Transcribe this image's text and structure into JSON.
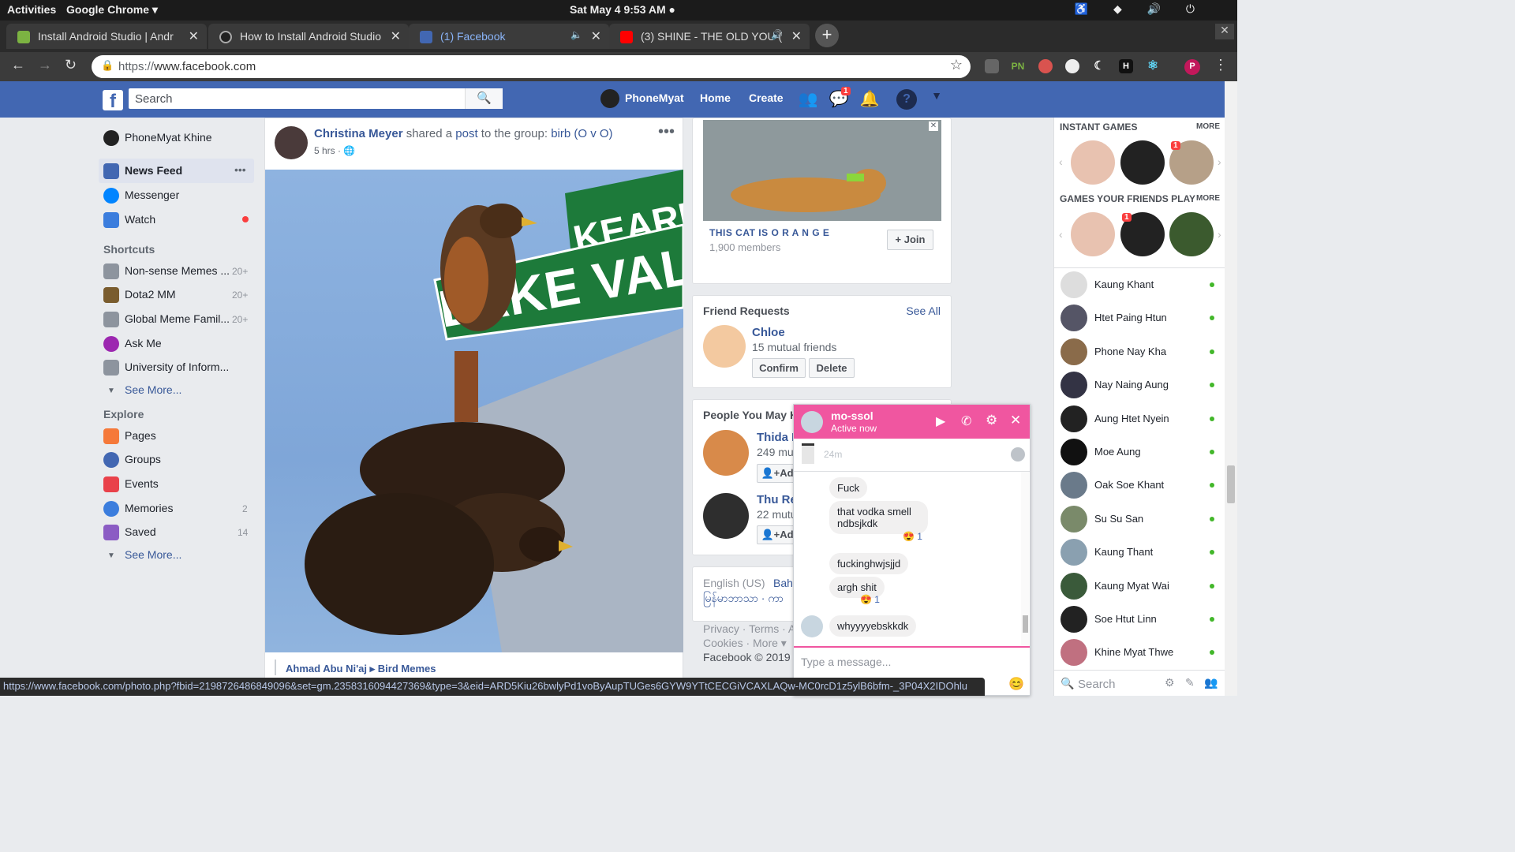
{
  "gnome": {
    "activities": "Activities",
    "app": "Google Chrome ▾",
    "clock": "Sat May 4   9:53 AM ●"
  },
  "tabs": [
    {
      "title": "Install Android Studio  |  Andr",
      "fav_color": "#7cb342"
    },
    {
      "title": "How to Install Android Studio",
      "fav_color": "#222222"
    },
    {
      "title": "(1) Facebook",
      "fav_color": "#4267b2"
    },
    {
      "title": "(3) SHINE - THE OLD YOU (",
      "fav_color": "#ff0000"
    }
  ],
  "omnibox": {
    "scheme": "https://",
    "host": "www.facebook.com"
  },
  "extensions": {
    "pn": "PN",
    "profile": "P"
  },
  "fb": {
    "logo": "f",
    "search_placeholder": "Search",
    "user": "PhoneMyat",
    "home": "Home",
    "create": "Create",
    "messenger_badge": "1",
    "brand_color": "#4267b2"
  },
  "leftnav": {
    "profile": "PhoneMyat Khine",
    "main": [
      {
        "label": "News Feed"
      },
      {
        "label": "Messenger"
      },
      {
        "label": "Watch"
      }
    ],
    "news_more": "•••",
    "shortcuts_title": "Shortcuts",
    "shortcuts": [
      {
        "label": "Non-sense Memes ...",
        "count": "20+"
      },
      {
        "label": "Dota2 MM",
        "count": "20+"
      },
      {
        "label": "Global Meme Famil...",
        "count": "20+"
      },
      {
        "label": "Ask Me",
        "count": ""
      },
      {
        "label": "University of Inform...",
        "count": ""
      }
    ],
    "see_more_1": "See More...",
    "explore_title": "Explore",
    "explore": [
      {
        "label": "Pages",
        "count": ""
      },
      {
        "label": "Groups",
        "count": ""
      },
      {
        "label": "Events",
        "count": ""
      },
      {
        "label": "Memories",
        "count": "2"
      },
      {
        "label": "Saved",
        "count": "14"
      }
    ],
    "see_more_2": "See More..."
  },
  "post": {
    "author": "Christina Meyer",
    "shared": " shared a ",
    "post": "post",
    "to": " to the group: ",
    "group": "birb (O v O)",
    ".": ".",
    "time": "5 hrs · ",
    "more": "•••",
    "sign_text": "LAKE VAL",
    "sign_text2": "KEARN",
    "footer_author": "Ahmad Abu Ni'aj",
    "footer_group": "Bird Memes"
  },
  "group_card": {
    "name": "THIS CAT IS O R A N G E",
    "members": "1,900 members",
    "join": "+ Join"
  },
  "friend_requests": {
    "title": "Friend Requests",
    "see_all": "See All",
    "name": "Chloe",
    "mutual": "15 mutual friends",
    "confirm": "Confirm",
    "delete": "Delete"
  },
  "pymk": {
    "title": "People You May K",
    "p1_name": "Thida N",
    "p1_mutual": "249 mu",
    "p2_name": "Thu Re",
    "p2_mutual": "22 mutu",
    "add": "Add"
  },
  "footer": {
    "lang": "English (US)",
    "lang2": "Bah",
    "lang3": "မြန်မာဘာသာ · ကာ",
    "links": "Privacy · Terms · A",
    "links2": "Cookies · More ▾",
    "copy": "Facebook © 2019"
  },
  "chat": {
    "name": "mo-ssol",
    "status": "Active now",
    "time": "24m",
    "messages": [
      "Fuck",
      "that vodka smell ndbsjkdk",
      "fuckinghwjsjjd",
      "argh shit",
      "whyyyyebskkdk"
    ],
    "reaction": "😍 1",
    "input_placeholder": "Type a message...",
    "color": "#f056a0"
  },
  "sidebar": {
    "instant_games": "INSTANT GAMES",
    "more": "MORE",
    "friends_play": "GAMES YOUR FRIENDS PLAY",
    "game_badge": "1",
    "contacts": [
      "Kaung Khant",
      "Htet Paing Htun",
      "Phone Nay Kha",
      "Nay Naing Aung",
      "Aung Htet Nyein",
      "Moe Aung",
      "Oak Soe Khant",
      "Su Su San",
      "Kaung Thant",
      "Kaung Myat Wai",
      "Soe Htut Linn",
      "Khine Myat Thwe"
    ],
    "search": "Search"
  },
  "statusbar": "https://www.facebook.com/photo.php?fbid=2198726486849096&set=gm.2358316094427369&type=3&eid=ARD5Kiu26bwlyPd1voByAupTUGes6GYW9YTtCECGiVCAXLAQw-MC0rcD1z5ylB6bfm-_3P04X2IDOhlu"
}
